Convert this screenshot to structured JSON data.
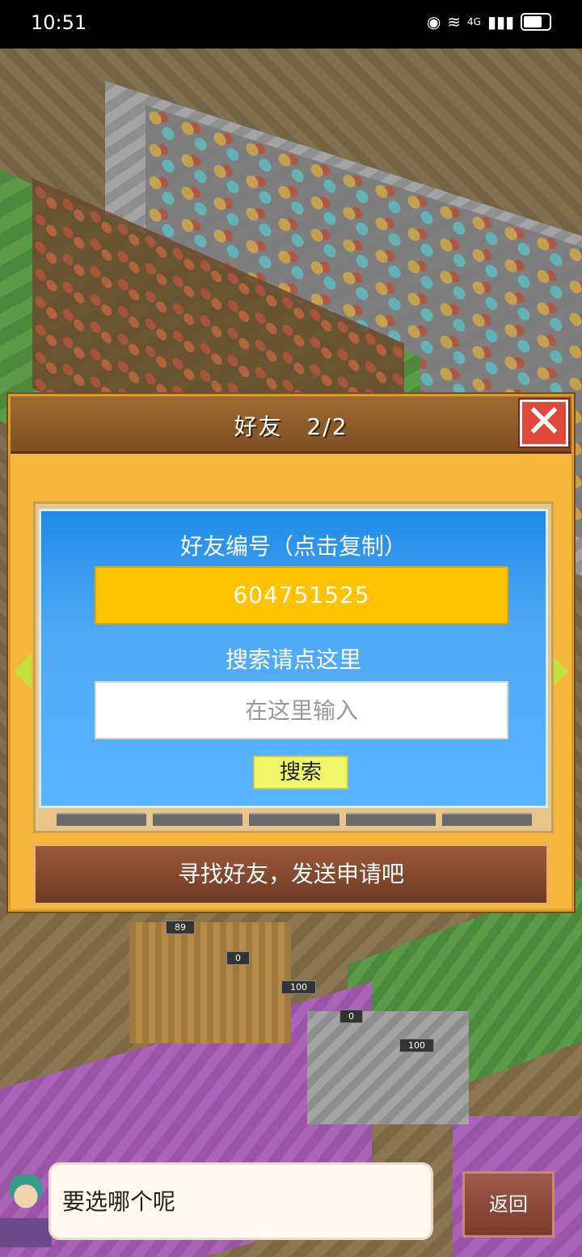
{
  "status_bar": {
    "time": "10:51",
    "network": "4G"
  },
  "scene": {
    "building_counts": [
      "89",
      "0",
      "100",
      "0",
      "100"
    ]
  },
  "dialog": {
    "title": "好友　2/2",
    "close_symbol": "✕",
    "friend_id_label": "好友编号（点击复制）",
    "friend_id_value": "604751525",
    "search_label": "搜索请点这里",
    "search_placeholder": "在这里输入",
    "search_button": "搜索",
    "find_friends_button": "寻找好友，发送申请吧"
  },
  "bottom": {
    "speech_text": "要选哪个呢",
    "back_button": "返回"
  },
  "colors": {
    "dialog_bg": "#f5b73b",
    "panel_blue": "#2f96f0",
    "id_box": "#ffc300",
    "search_button": "#f1f56a",
    "close_button": "#e2483a"
  }
}
